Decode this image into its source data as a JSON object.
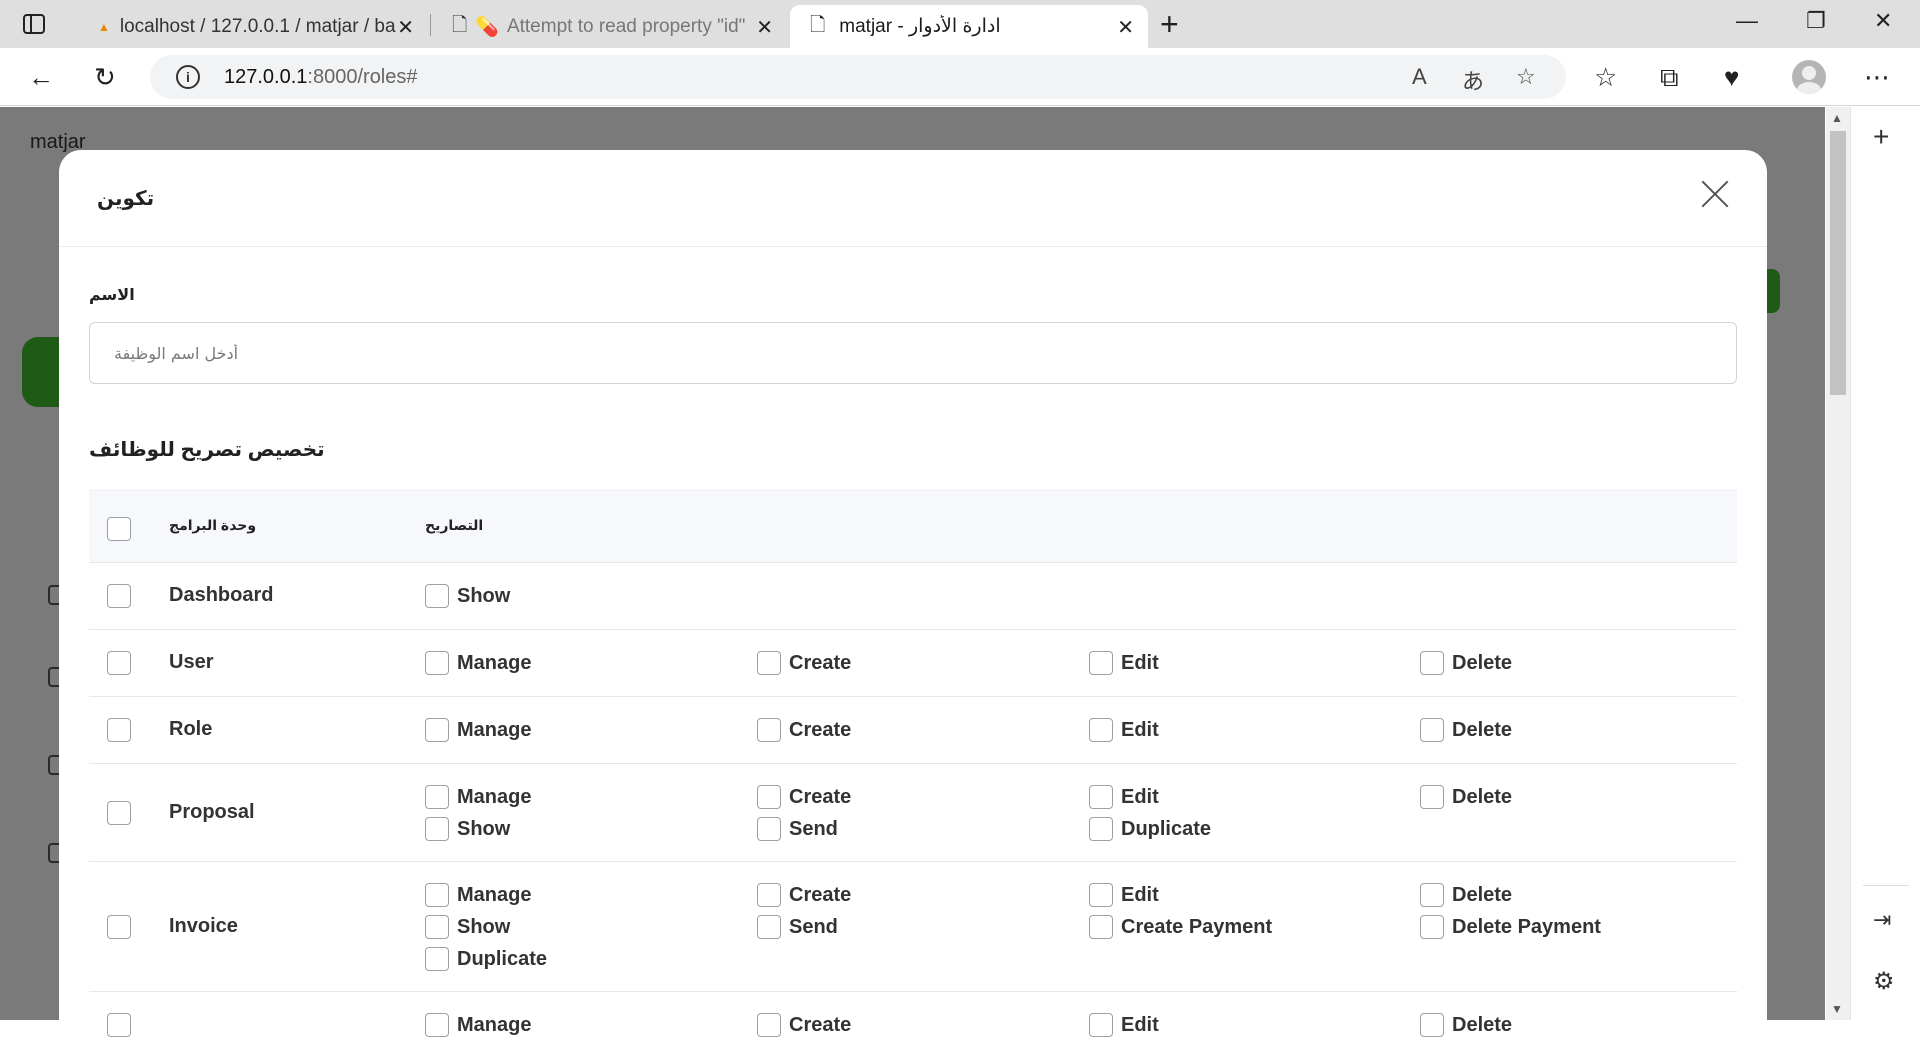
{
  "browser": {
    "tabs": [
      {
        "title": "localhost / 127.0.0.1 / matjar / ba",
        "icon": "phpmyadmin-icon"
      },
      {
        "title": "Attempt to read property \"id\"",
        "icon": "page-icon"
      },
      {
        "title": "matjar - ادارة الأدوار",
        "icon": "page-icon"
      }
    ],
    "url_host": "127.0.0.1",
    "url_path": ":8000/roles#"
  },
  "page": {
    "logo_alt": "matjar"
  },
  "modal": {
    "title": "تكوين",
    "name_label": "الاسم",
    "name_placeholder": "أدخل اسم الوظيفة",
    "section_title": "تخصيص تصريح للوظائف",
    "table": {
      "col_module": "وحدة البرامج",
      "col_permissions": "التصاريح",
      "rows": [
        {
          "module": "Dashboard",
          "permissions": [
            "Show"
          ]
        },
        {
          "module": "User",
          "permissions": [
            "Manage",
            "Create",
            "Edit",
            "Delete"
          ]
        },
        {
          "module": "Role",
          "permissions": [
            "Manage",
            "Create",
            "Edit",
            "Delete"
          ]
        },
        {
          "module": "Proposal",
          "permissions": [
            "Manage",
            "Create",
            "Edit",
            "Delete",
            "Show",
            "Send",
            "Duplicate"
          ]
        },
        {
          "module": "Invoice",
          "permissions": [
            "Manage",
            "Create",
            "Edit",
            "Delete",
            "Show",
            "Send",
            "Create Payment",
            "Delete Payment",
            "Duplicate"
          ]
        },
        {
          "module": "",
          "permissions": [
            "Manage",
            "Create",
            "Edit",
            "Delete"
          ]
        }
      ]
    }
  }
}
